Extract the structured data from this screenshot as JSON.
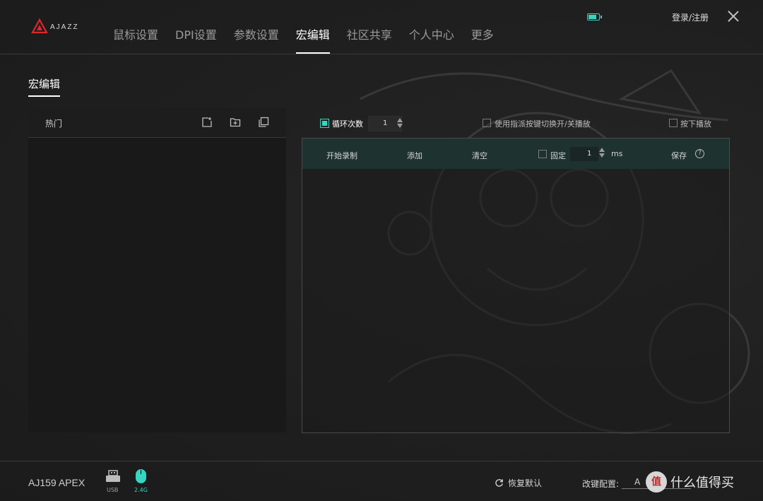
{
  "app": {
    "logo_text": "AJAZZ"
  },
  "nav": {
    "items": [
      "鼠标设置",
      "DPI设置",
      "参数设置",
      "宏编辑",
      "社区共享",
      "个人中心",
      "更多"
    ],
    "active_index": 3
  },
  "header": {
    "login_label": "登录/注册"
  },
  "page": {
    "section_title": "宏编辑"
  },
  "left_panel": {
    "title": "热门"
  },
  "loop": {
    "label": "循环次数",
    "count": "1",
    "checked": true
  },
  "options": {
    "toggle_play_label": "使用指派按键切换开/关播放",
    "press_play_label": "按下播放"
  },
  "toolbar": {
    "start_record": "开始录制",
    "add": "添加",
    "clear": "清空",
    "fixed_label": "固定",
    "fixed_value": "1",
    "unit": "ms",
    "save": "保存",
    "help_symbol": "?"
  },
  "footer": {
    "device_name": "AJ159 APEX",
    "usb_label": "USB",
    "wireless_label": "2.4G",
    "restore_label": "恢复默认",
    "keyconf_label": "改键配置:",
    "keyconf_value": "A",
    "watermark_badge": "值",
    "watermark_text": "什么值得买"
  },
  "colors": {
    "accent": "#36d6c3",
    "logo_red": "#e0262b",
    "toolbar_bg": "#1e3330"
  }
}
